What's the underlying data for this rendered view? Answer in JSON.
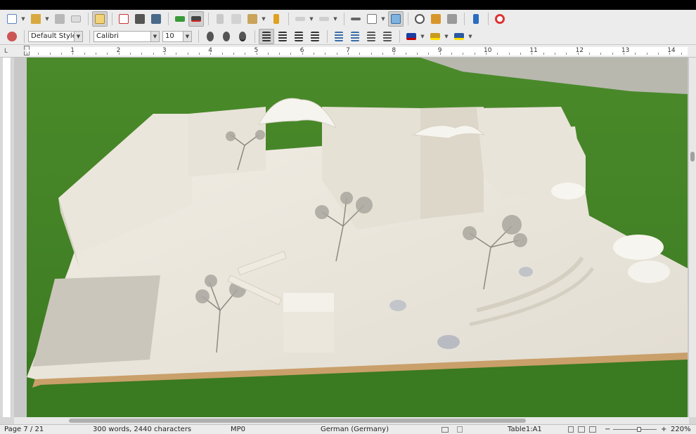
{
  "toolbar_standard": {
    "icons": [
      "new-document-icon",
      "open-icon",
      "save-icon",
      "email-icon",
      "edit-mode-icon",
      "export-pdf-icon",
      "print-icon",
      "print-preview-icon",
      "spellcheck-icon",
      "autospell-icon",
      "cut-icon",
      "copy-icon",
      "paste-icon",
      "clone-formatting-icon",
      "undo-icon",
      "redo-icon",
      "hyperlink-icon",
      "table-icon",
      "image-icon",
      "navigator-icon",
      "gallery-icon",
      "data-sources-icon",
      "formatting-marks-icon",
      "help-icon"
    ]
  },
  "toolbar_formatting": {
    "paragraph_style": "Default Style",
    "font_name": "Calibri",
    "font_size": "10"
  },
  "ruler": {
    "numbers": [
      "1",
      "2",
      "3",
      "4",
      "5",
      "6",
      "7",
      "8",
      "9",
      "10",
      "11",
      "12",
      "13",
      "14"
    ]
  },
  "status_bar": {
    "page": "Page 7 / 21",
    "word_count": "300 words, 2440 characters",
    "page_style": "MP0",
    "language": "German (Germany)",
    "cell": "Table1:A1",
    "zoom": "220%",
    "zoom_minus": "−",
    "zoom_plus": "+"
  },
  "colors": {
    "font_color": "#c00000",
    "highlight_color": "#ffe000",
    "background_color": "#ffe000"
  }
}
